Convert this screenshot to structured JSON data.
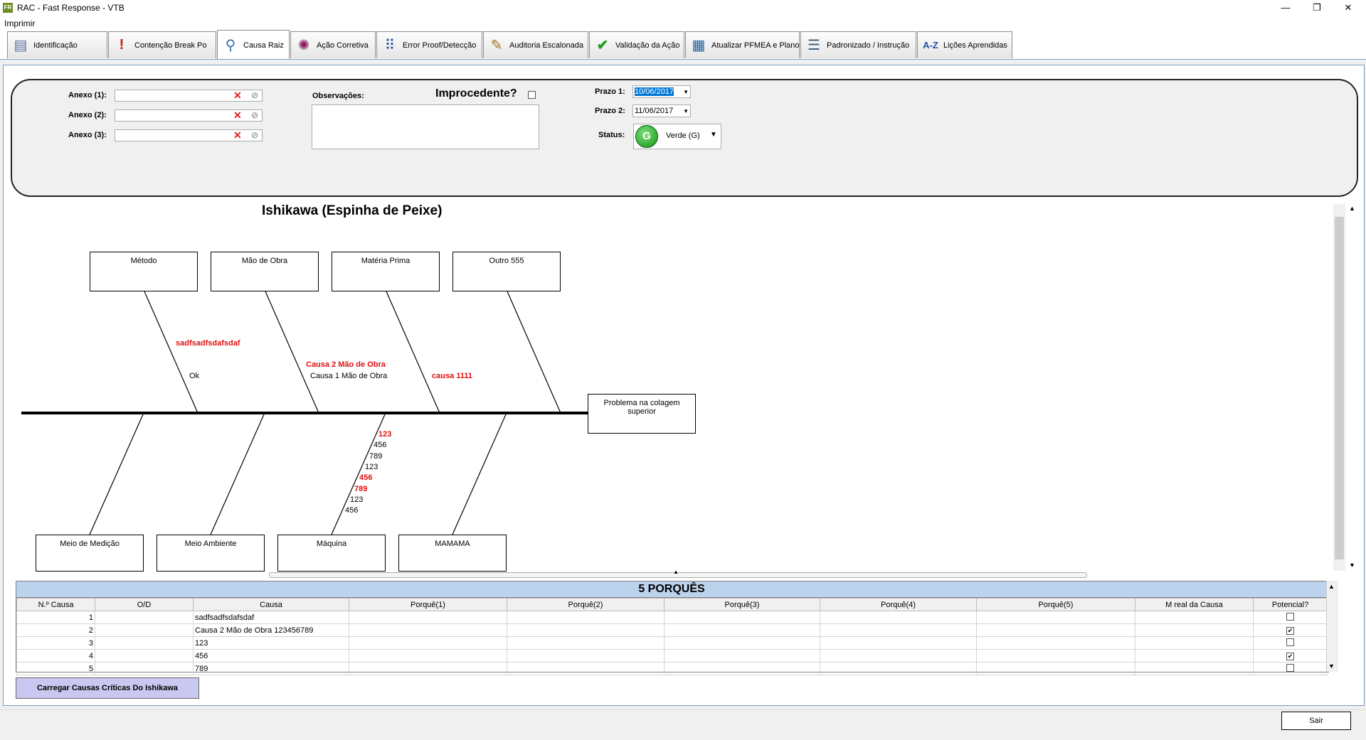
{
  "window": {
    "title": "RAC - Fast Response - VTB",
    "app_badge": "FR",
    "minimize": "—",
    "restore": "❐",
    "close": "✕"
  },
  "menu": {
    "print": "Imprimir"
  },
  "tabs": [
    {
      "label": "Identificação",
      "icon": "form-icon"
    },
    {
      "label": "Contenção Break Po",
      "icon": "exclamation-icon"
    },
    {
      "label": "Causa Raiz",
      "icon": "microscope-icon"
    },
    {
      "label": "Ação Corretiva",
      "icon": "bug-icon"
    },
    {
      "label": "Error Proof/Detecção",
      "icon": "abacus-icon"
    },
    {
      "label": "Auditoria Escalonada",
      "icon": "pencil-doc-icon"
    },
    {
      "label": "Validação da Ação",
      "icon": "check-icon"
    },
    {
      "label": "Atualizar PFMEA e Plano",
      "icon": "table-icon"
    },
    {
      "label": "Padronizado / Instrução",
      "icon": "list-icon"
    },
    {
      "label": "Lições Aprendidas",
      "icon": "az-icon"
    }
  ],
  "header": {
    "anexo1_label": "Anexo (1):",
    "anexo2_label": "Anexo (2):",
    "anexo3_label": "Anexo (3):",
    "obs_label": "Observações:",
    "improcedente_label": "Improcedente?",
    "prazo1_label": "Prazo 1:",
    "prazo1_value": "10/06/2017",
    "prazo2_label": "Prazo 2:",
    "prazo2_value": "11/06/2017",
    "status_label": "Status:",
    "status_badge": "G",
    "status_value": "Verde (G)",
    "status_color": "#129412"
  },
  "ishikawa": {
    "title": "Ishikawa (Espinha de Peixe)",
    "effect": "Problema na colagem superior",
    "top_boxes": [
      "Método",
      "Mão de Obra",
      "Matéria Prima",
      "Outro 555"
    ],
    "bottom_boxes": [
      "Meio de Medição",
      "Meio Ambiente",
      "Máquina",
      "MAMAMA"
    ],
    "causes": {
      "metodo": [
        "sadfsadfsdafsdaf",
        "Ok"
      ],
      "mao_de_obra": [
        "Causa 2 Mão de Obra",
        "Causa 1 Mão de Obra"
      ],
      "materia_prima": [
        "causa 1111"
      ],
      "maquina": [
        "123",
        "456",
        "789",
        "123",
        "456",
        "789",
        "123",
        "456"
      ]
    }
  },
  "porques": {
    "title": "5 PORQUÊS",
    "columns": [
      "N.º Causa",
      "O/D",
      "Causa",
      "Porquê(1)",
      "Porquê(2)",
      "Porquê(3)",
      "Porquê(4)",
      "Porquê(5)",
      "M real da Causa",
      "Potencial?"
    ],
    "rows": [
      {
        "n": "1",
        "od": "",
        "causa": "sadfsadfsdafsdaf",
        "potencial": false
      },
      {
        "n": "2",
        "od": "",
        "causa": "Causa 2 Mão de Obra 123456789",
        "potencial": true
      },
      {
        "n": "3",
        "od": "",
        "causa": "123",
        "potencial": false
      },
      {
        "n": "4",
        "od": "",
        "causa": "456",
        "potencial": true
      },
      {
        "n": "5",
        "od": "",
        "causa": "789",
        "potencial": false
      }
    ]
  },
  "buttons": {
    "load": "Carregar Causas Críticas Do Ishikawa",
    "exit": "Sair"
  }
}
